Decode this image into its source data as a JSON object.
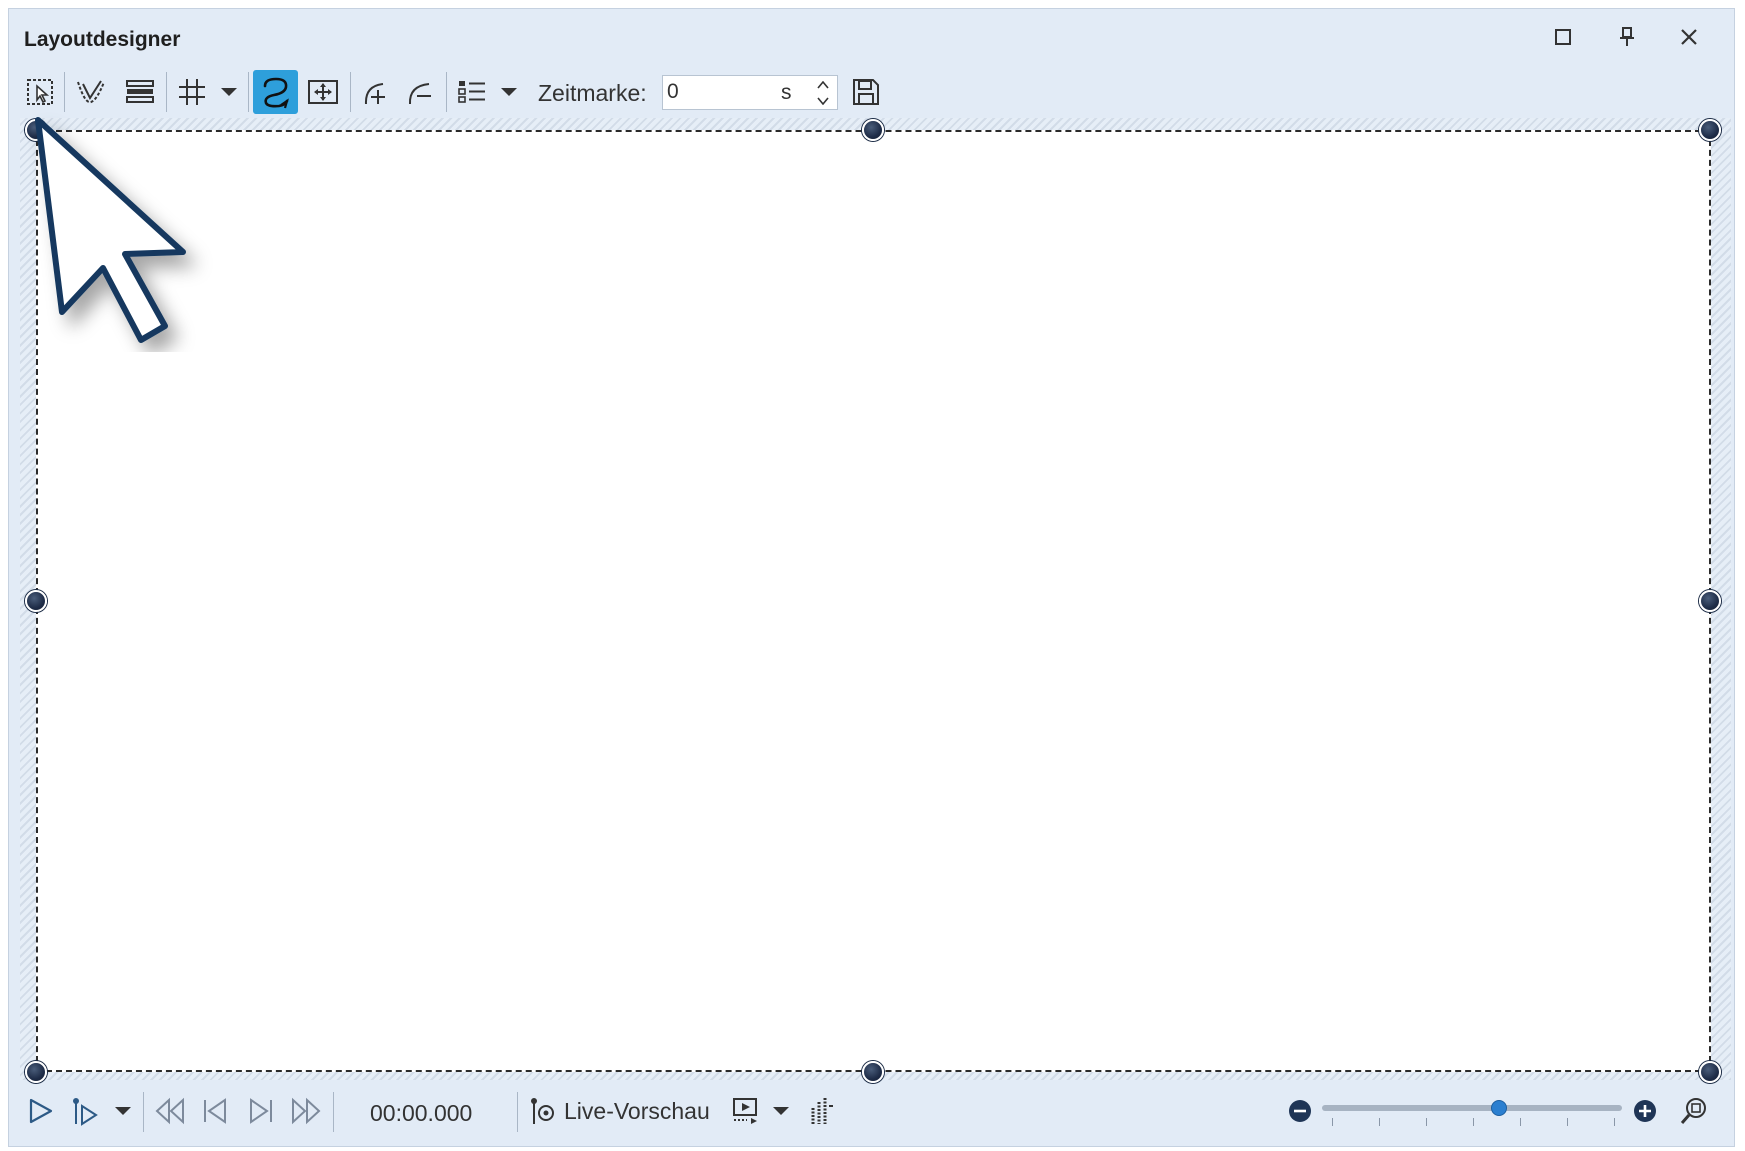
{
  "window": {
    "title": "Layoutdesigner",
    "buttons": [
      "maximize-icon",
      "pin-icon",
      "close-icon"
    ]
  },
  "toolbar": {
    "tools": [
      "select-icon",
      "node-edit-icon",
      "layers-icon",
      "grid-icon",
      "dropdown-arrow-icon",
      "path-curve-icon",
      "keyframe-frame-icon",
      "add-node-icon",
      "remove-node-icon",
      "list-icon",
      "dropdown-arrow-icon"
    ],
    "active_tool": "path-curve-icon",
    "zeitmarke_label": "Zeitmarke:",
    "zeitmarke_value": "0",
    "zeitmarke_unit": "s",
    "save_icon": "save-icon"
  },
  "canvas": {
    "handles": [
      "top-left",
      "top-center",
      "top-right",
      "middle-left",
      "middle-right",
      "bottom-left",
      "bottom-center",
      "bottom-right"
    ]
  },
  "playback": {
    "time": "00:00.000",
    "live_preview_label": "Live-Vorschau",
    "zoom_level": 0.59
  },
  "colors": {
    "window_bg": "#e2ebf6",
    "accent": "#2e9fdb",
    "handle": "#1f2d48",
    "cursor_outline": "#12385e"
  }
}
